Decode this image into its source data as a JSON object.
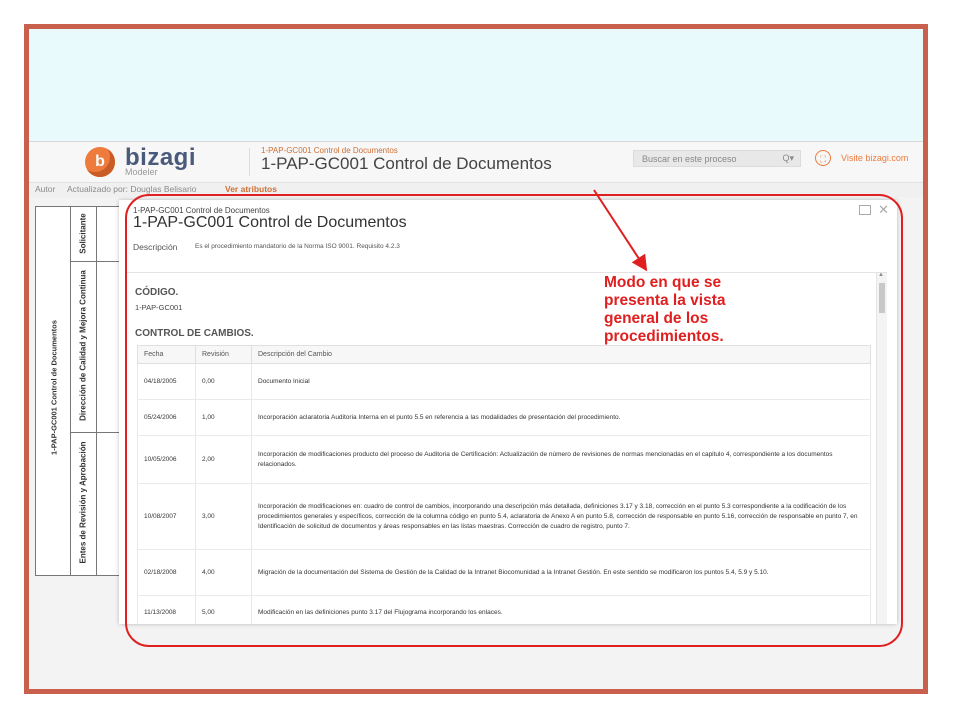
{
  "app": {
    "logo_letter": "b",
    "logo_text": "bizagi",
    "logo_subtext": "Modeler",
    "breadcrumb": "1-PAP-GC001 Control de Documentos",
    "title": "1-PAP-GC001 Control de Documentos",
    "search_placeholder": "Buscar en este proceso",
    "search_icon": "Q▾",
    "expand_icon": "⛶",
    "visit_link": "Visite bizagi.com",
    "author_label": "Autor",
    "updated_by": "Actualizado por: Douglas Belisario",
    "view_attributes": "Ver atributos"
  },
  "diagram": {
    "pool": "1-PAP-GC001 Control de Documentos",
    "lanes": [
      "Solicitante",
      "Dirección de Calidad y Mejora Continua",
      "Entes de Revisión y Aprobación"
    ]
  },
  "modal": {
    "breadcrumb": "1-PAP-GC001 Control de Documentos",
    "title": "1-PAP-GC001 Control de Documentos",
    "description_label": "Descripción",
    "description": "Es el procedimiento mandatorio de la Norma ISO 9001. Requisito 4.2.3",
    "close_icon": "✕",
    "code_heading": "CÓDIGO.",
    "code_value": "1-PAP-GC001",
    "changes_heading": "CONTROL DE CAMBIOS.",
    "columns": [
      "Fecha",
      "Revisión",
      "Descripción del Cambio"
    ],
    "rows": [
      {
        "fecha": "04/18/2005",
        "revision": "0,00",
        "descripcion": "Documento Inicial"
      },
      {
        "fecha": "05/24/2006",
        "revision": "1,00",
        "descripcion": "Incorporación aclaratoria Auditoria Interna en el punto 5.5 en referencia a las modalidades de presentación del procedimiento."
      },
      {
        "fecha": "10/05/2006",
        "revision": "2,00",
        "descripcion": "Incorporación de modificaciones producto del proceso de Auditoria de Certificación: Actualización de número de revisiones de normas mencionadas en el capitulo 4, correspondiente a los documentos relacionados."
      },
      {
        "fecha": "10/08/2007",
        "revision": "3,00",
        "descripcion": "Incorporación de modificaciones en: cuadro de control de cambios, incorporando una descripción más detallada, definiciones 3.17 y 3.18, corrección en el punto 5.3 correspondiente a la codificación de los procedimientos generales y específicos, corrección de la columna código en punto 5.4, aclaratoria de Anexo A en punto 5.8, corrección de responsable en punto 5.16, corrección de responsable en punto 7, en Identificación de solicitud de documentos y áreas responsables en las listas maestras. Corrección de cuadro de registro, punto 7."
      },
      {
        "fecha": "02/18/2008",
        "revision": "4,00",
        "descripcion": "Migración de la documentación del Sistema de Gestión de la Calidad de la Intranet Biocomunidad a la Intranet Gestión. En este sentido se modificaron los puntos 5.4, 5.9 y 5.10."
      },
      {
        "fecha": "11/13/2008",
        "revision": "5,00",
        "descripcion": "Modificación en las definiciones punto 3.17 del Flujograma incorporando los enlaces."
      }
    ]
  },
  "annotation": {
    "text": "Modo en que se presenta la vista general de los procedimientos.",
    "color": "#e02020"
  },
  "colors": {
    "frame": "#c8604d",
    "slide_bg": "#e9fafc",
    "accent": "#ee7b3c"
  }
}
